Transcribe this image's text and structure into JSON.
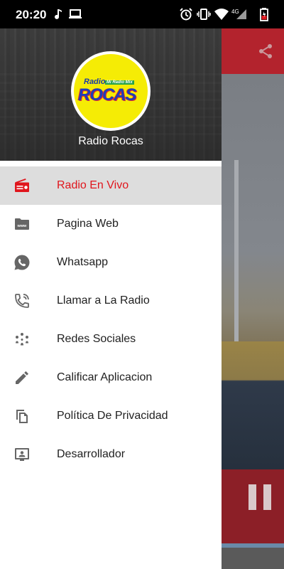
{
  "status_bar": {
    "time": "20:20",
    "network": "4G"
  },
  "drawer": {
    "station_name": "Radio Rocas",
    "logo": {
      "radio_text": "Radio",
      "tagline": "Mi Radio Mix",
      "brand": "ROCAS"
    },
    "items": [
      {
        "label": "Radio En Vivo",
        "icon": "radio-icon",
        "active": true
      },
      {
        "label": "Pagina Web",
        "icon": "www-folder-icon",
        "active": false
      },
      {
        "label": "Whatsapp",
        "icon": "whatsapp-icon",
        "active": false
      },
      {
        "label": "Llamar a La Radio",
        "icon": "phone-call-icon",
        "active": false
      },
      {
        "label": "Redes Sociales",
        "icon": "social-network-icon",
        "active": false
      },
      {
        "label": "Calificar Aplicacion",
        "icon": "pencil-icon",
        "active": false
      },
      {
        "label": "Política De Privacidad",
        "icon": "copy-document-icon",
        "active": false
      },
      {
        "label": "Desarrollador",
        "icon": "developer-screen-icon",
        "active": false
      }
    ]
  },
  "colors": {
    "accent": "#e0161d",
    "toolbar": "#b3232d",
    "icon_gray": "#666666",
    "logo_yellow": "#f5ec05"
  }
}
